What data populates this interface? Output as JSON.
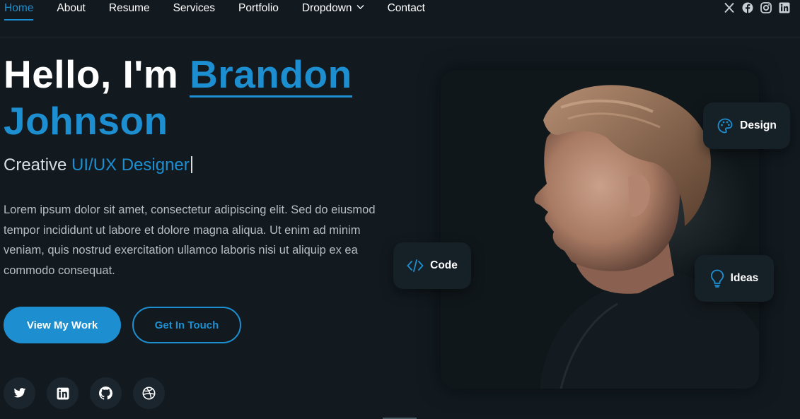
{
  "nav": {
    "items": [
      {
        "label": "Home",
        "active": true
      },
      {
        "label": "About"
      },
      {
        "label": "Resume"
      },
      {
        "label": "Services"
      },
      {
        "label": "Portfolio"
      },
      {
        "label": "Dropdown",
        "has_dropdown": true
      },
      {
        "label": "Contact"
      }
    ],
    "social_icons": [
      "x-icon",
      "facebook-icon",
      "instagram-icon",
      "linkedin-icon"
    ]
  },
  "hero": {
    "greeting": "Hello, I'm ",
    "first_name": "Brandon",
    "last_name": "Johnson",
    "subtitle_prefix": "Creative ",
    "subtitle_role": "UI/UX Designer",
    "description": "Lorem ipsum dolor sit amet, consectetur adipiscing elit. Sed do eiusmod tempor incididunt ut labore et dolore magna aliqua. Ut enim ad minim veniam, quis nostrud exercitation ullamco laboris nisi ut aliquip ex ea commodo consequat.",
    "primary_button": "View My Work",
    "secondary_button": "Get In Touch",
    "social_icons": [
      "twitter-icon",
      "linkedin-icon",
      "github-icon",
      "dribbble-icon"
    ]
  },
  "cards": {
    "design": "Design",
    "code": "Code",
    "ideas": "Ideas"
  },
  "colors": {
    "accent": "#1d8fd1",
    "background": "#121a20",
    "card": "#162027"
  }
}
